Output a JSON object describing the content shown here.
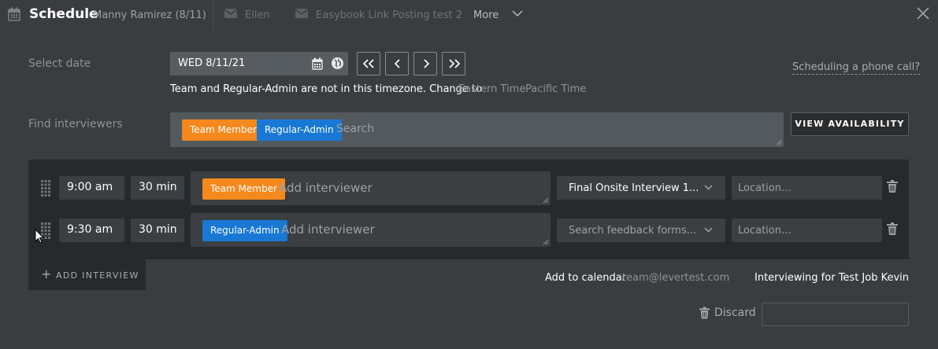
{
  "header": {
    "title": "Schedule",
    "candidate": "Manny Ramirez (8/11)",
    "tabs": [
      "Ellen",
      "Easybook Link Posting test 2"
    ],
    "more_label": "More"
  },
  "date_section": {
    "label": "Select date",
    "date_value": "WED 8/11/21",
    "timezone_message": "Team and Regular-Admin are not in this timezone. Change to",
    "timezone_options": [
      "Eastern Time",
      "Pacific Time"
    ],
    "phone_link": "Scheduling a phone call?"
  },
  "find_section": {
    "label": "Find interviewers",
    "chips": [
      "Team Member",
      "Regular-Admin"
    ],
    "search_placeholder": "Search",
    "view_button": "VIEW AVAILABILITY"
  },
  "interviews": [
    {
      "time": "9:00 am",
      "duration": "30 min",
      "chip": "Team Member",
      "chip_color": "#f5891e",
      "placeholder": "Add interviewer",
      "feedback_form": "Final Onsite Interview 1...",
      "location_placeholder": "Location..."
    },
    {
      "time": "9:30 am",
      "duration": "30 min",
      "chip": "Regular-Admin",
      "chip_color": "#1878d4",
      "placeholder": "Add interviewer",
      "feedback_form": "Search feedback forms...",
      "location_placeholder": "Location..."
    }
  ],
  "add_interview_label": "ADD INTERVIEW",
  "footer": {
    "calendar_label": "Add to calendar",
    "calendar_email": "team@levertest.com",
    "interviewing_for": "Interviewing for Test Job Kevin",
    "discard_label": "Discard"
  },
  "colors": {
    "background": "#3a3d40",
    "panel": "#272a2c",
    "orange_chip": "#f5891e",
    "blue_chip": "#1878d4"
  },
  "icons": [
    "calendar-icon",
    "mail-icon",
    "chevron-down-icon",
    "close-icon",
    "globe-icon",
    "drag-handle-icon",
    "trash-icon",
    "plus-icon"
  ]
}
